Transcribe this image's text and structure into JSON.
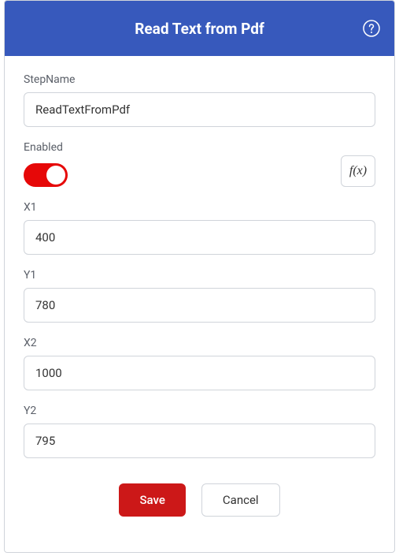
{
  "header": {
    "title": "Read Text from Pdf"
  },
  "fields": {
    "stepName": {
      "label": "StepName",
      "value": "ReadTextFromPdf"
    },
    "enabled": {
      "label": "Enabled",
      "value": true,
      "fxLabel": "f(x)"
    },
    "x1": {
      "label": "X1",
      "value": "400"
    },
    "y1": {
      "label": "Y1",
      "value": "780"
    },
    "x2": {
      "label": "X2",
      "value": "1000"
    },
    "y2": {
      "label": "Y2",
      "value": "795"
    }
  },
  "buttons": {
    "save": "Save",
    "cancel": "Cancel"
  }
}
